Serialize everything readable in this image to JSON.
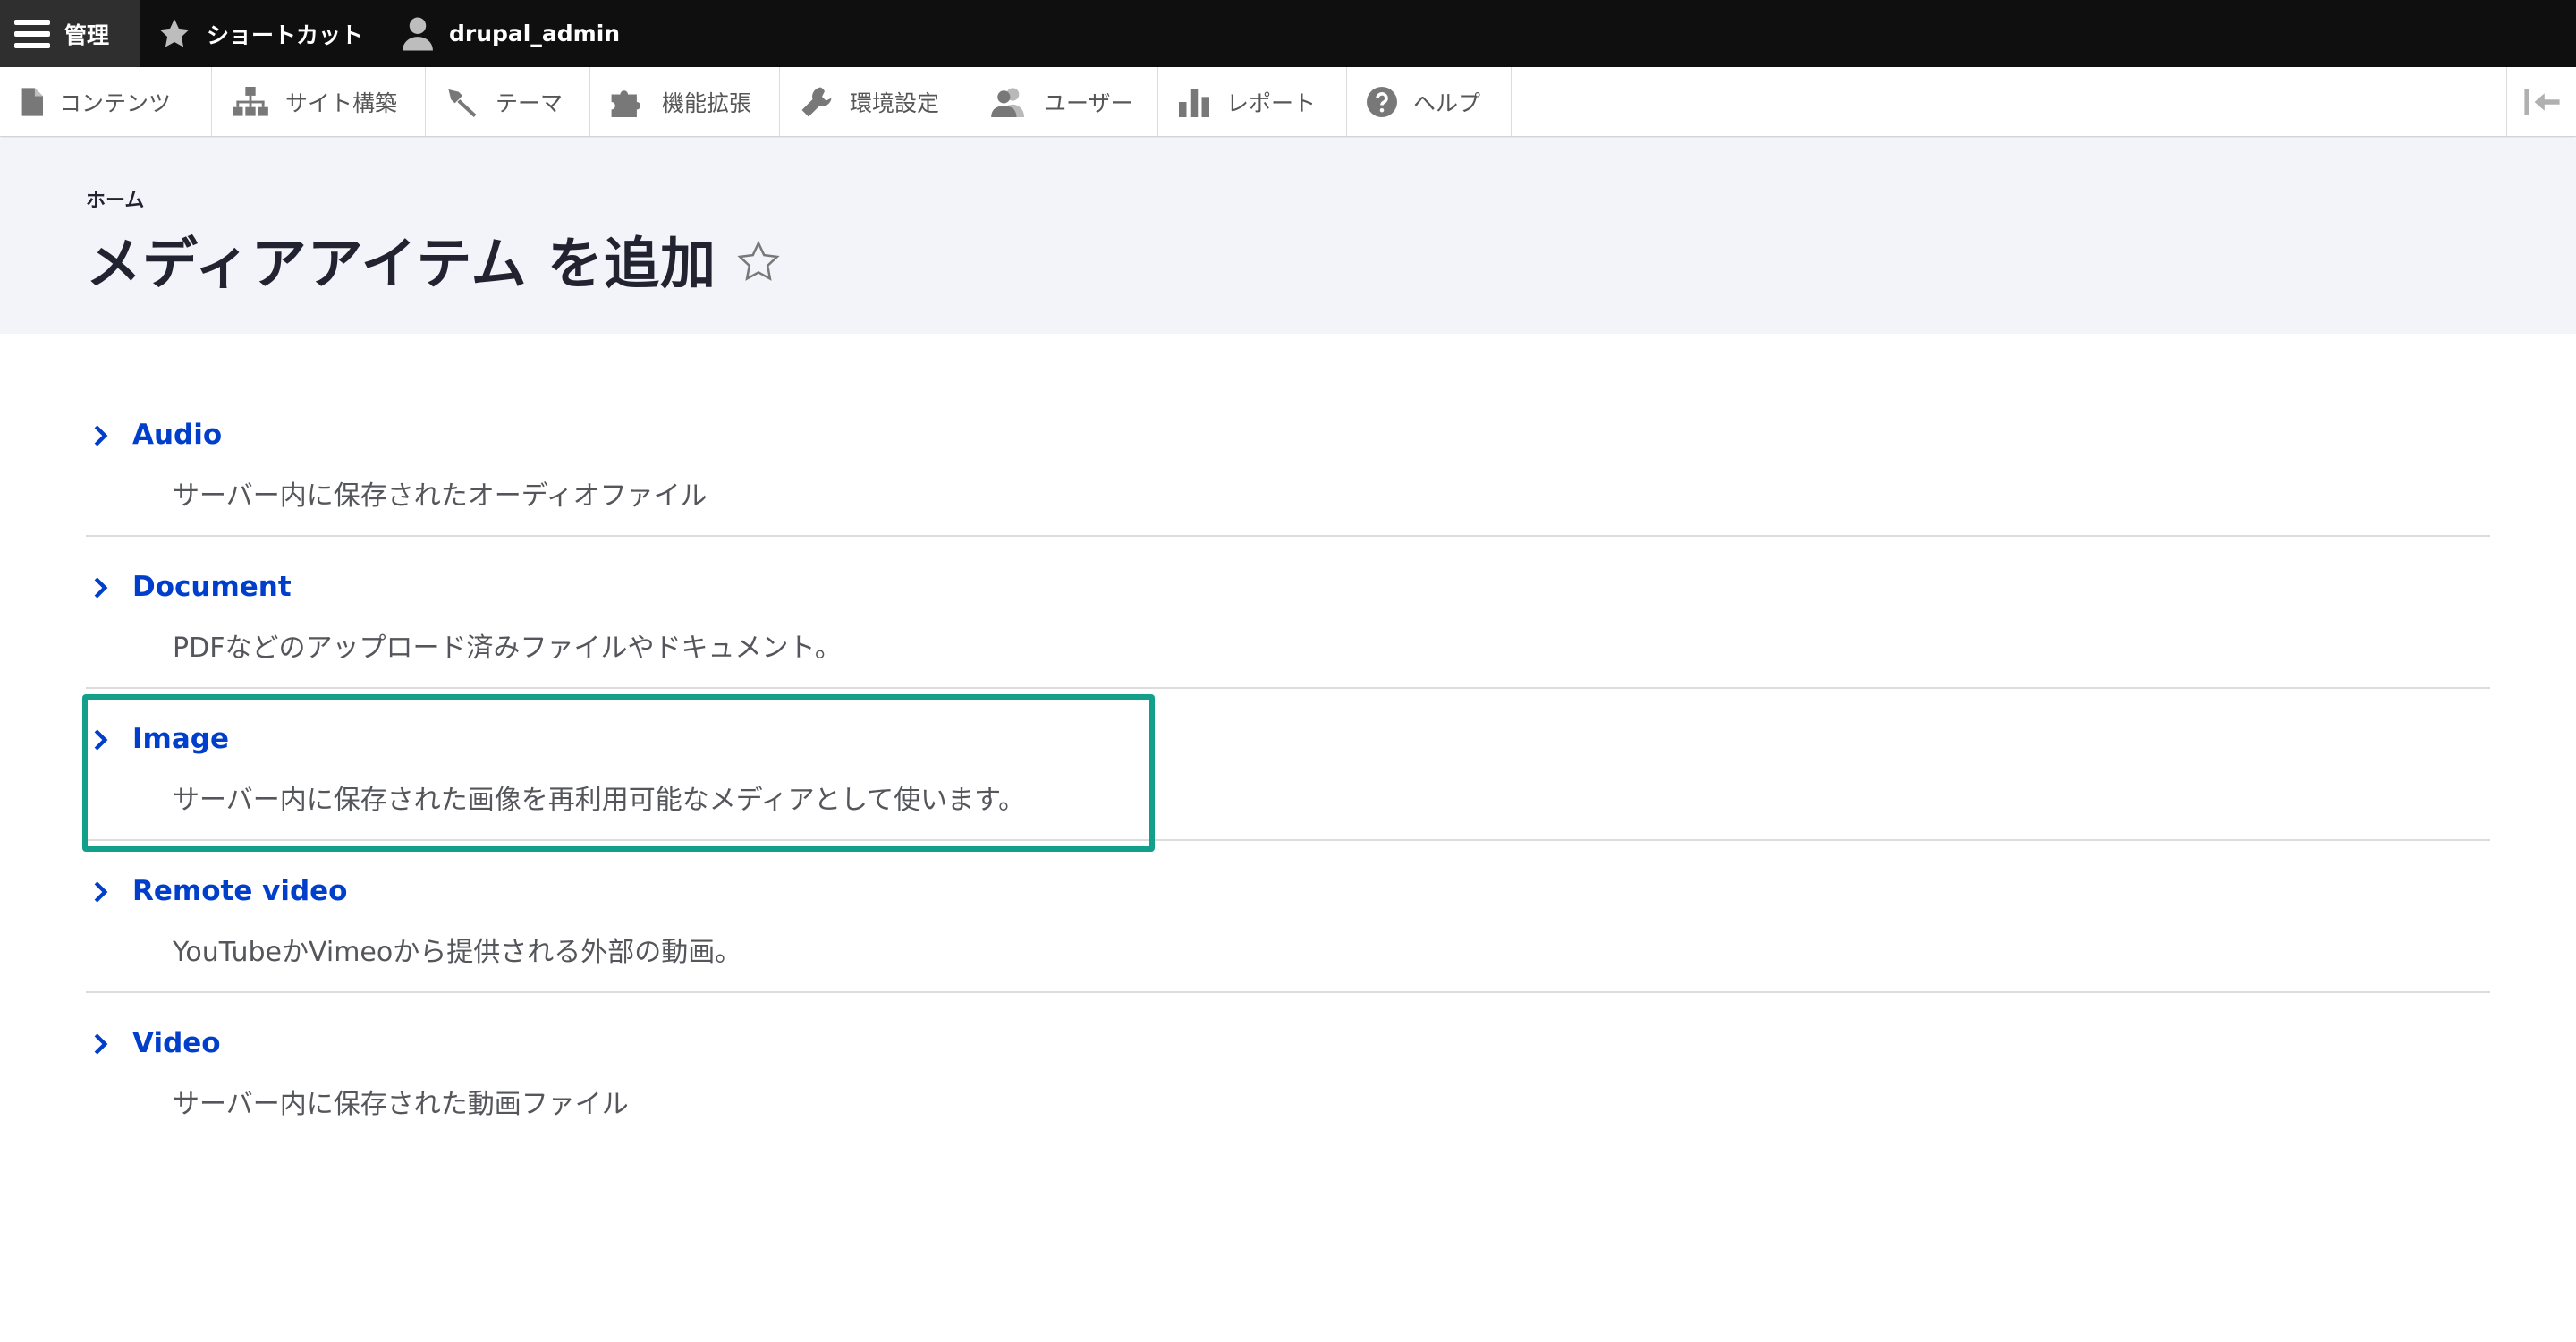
{
  "toolbar": {
    "manage_label": "管理",
    "shortcuts_label": "ショートカット",
    "user_label": "drupal_admin"
  },
  "tray": {
    "items": [
      {
        "label": "コンテンツ",
        "icon": "file-icon"
      },
      {
        "label": "サイト構築",
        "icon": "sitemap-icon"
      },
      {
        "label": "テーマ",
        "icon": "paint-brush-icon"
      },
      {
        "label": "機能拡張",
        "icon": "puzzle-icon"
      },
      {
        "label": "環境設定",
        "icon": "wrench-icon"
      },
      {
        "label": "ユーザー",
        "icon": "people-icon"
      },
      {
        "label": "レポート",
        "icon": "bar-chart-icon"
      },
      {
        "label": "ヘルプ",
        "icon": "help-icon"
      }
    ]
  },
  "header": {
    "breadcrumb": "ホーム",
    "title": "メディアアイテム を追加",
    "star": "☆"
  },
  "media_types": [
    {
      "title": "Audio",
      "description": "サーバー内に保存されたオーディオファイル"
    },
    {
      "title": "Document",
      "description": "PDFなどのアップロード済みファイルやドキュメント。"
    },
    {
      "title": "Image",
      "description": "サーバー内に保存された画像を再利用可能なメディアとして使います。"
    },
    {
      "title": "Remote video",
      "description": "YouTubeかVimeoから提供される外部の動画。"
    },
    {
      "title": "Video",
      "description": "サーバー内に保存された動画ファイル"
    }
  ],
  "colors": {
    "link": "#003ecc",
    "highlight": "#12a08a",
    "toolbar_bg": "#0f0f0f",
    "header_bg": "#f3f4f9"
  }
}
